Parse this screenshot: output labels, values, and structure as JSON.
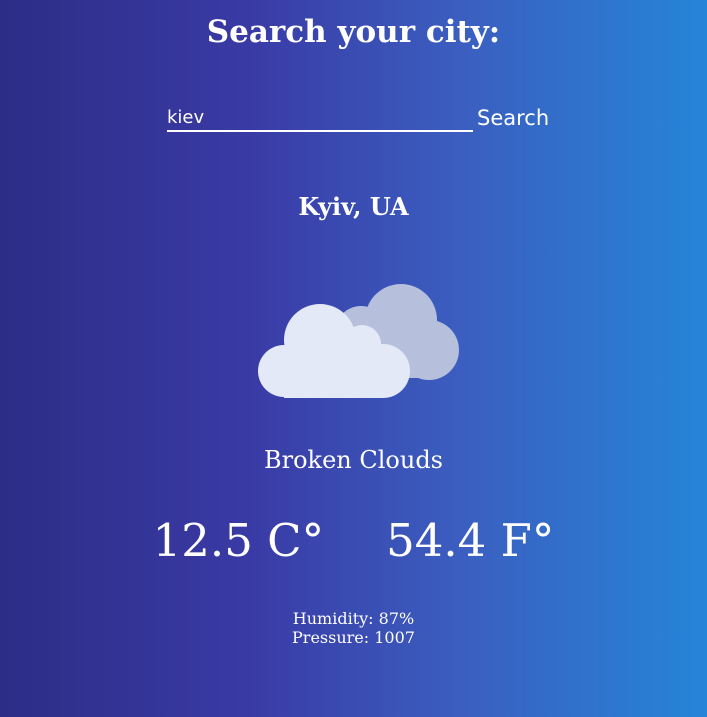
{
  "header": {
    "title": "Search your city:"
  },
  "search": {
    "value": "kiev",
    "button_label": "Search"
  },
  "weather": {
    "location": "Kyiv, UA",
    "icon": "broken-clouds-icon",
    "description": "Broken Clouds",
    "temp_c": "12.5 C°",
    "temp_f": "54.4 F°",
    "humidity": "Humidity: 87%",
    "pressure": "Pressure: 1007"
  },
  "colors": {
    "background_left": "#2c2d86",
    "background_right": "#2585d8",
    "cloud_front": "#e3e9f7",
    "cloud_back": "#b6c0dc"
  }
}
